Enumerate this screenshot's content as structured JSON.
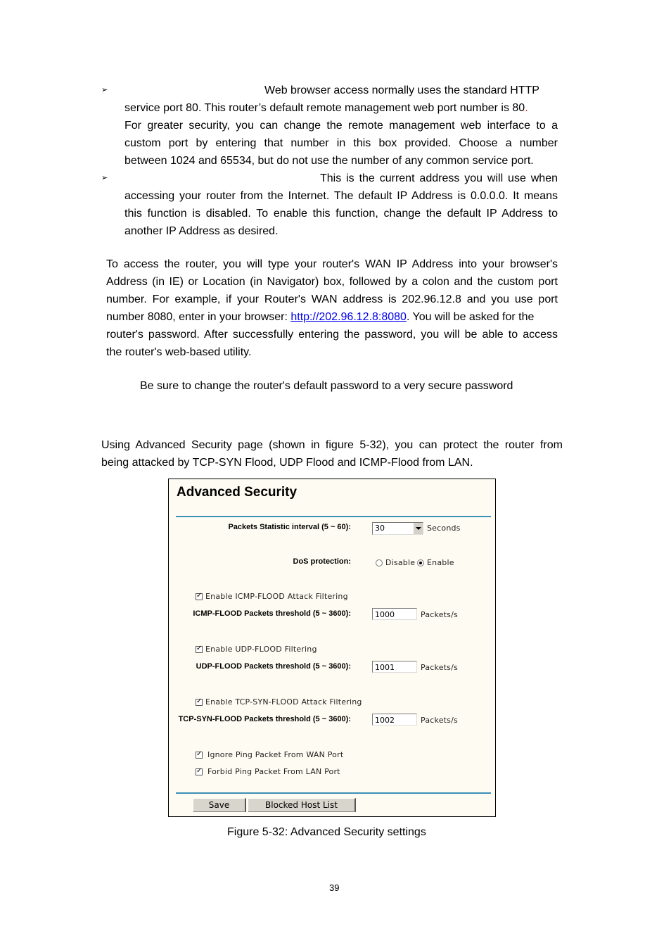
{
  "bullets": [
    {
      "symbol": "➢",
      "lines": [
        "Web browser access normally uses the standard HTTP",
        "service port 80. This router’s default remote management web port number is 80",
        "For greater security, you can change the remote management web interface to a",
        "custom port by entering that number in this box provided. Choose a number",
        "between 1024 and 65534, but do not use the number of any common service port."
      ],
      "red_period": "."
    },
    {
      "symbol": "➢",
      "lines": [
        "This is the current address you will use when",
        "accessing your router from the Internet. The default IP Address is 0.0.0.0. It means",
        "this function is disabled. To enable this function, change the default IP Address to",
        "another IP Address as desired."
      ]
    }
  ],
  "paragraph1": {
    "lines": [
      "To access the router, you will type your router's WAN IP Address into your browser's",
      "Address (in IE) or Location (in Navigator) box, followed by a colon and the custom port",
      "number. For example, if your Router's WAN address is 202.96.12.8 and you use port"
    ],
    "line4_before": "number 8080, enter in your browser: ",
    "link": "http://202.96.12.8:8080",
    "line4_after": ". You will be asked for the",
    "line5": "router's password. After successfully entering the password, you will be able to access",
    "line6": "the router's web-based utility."
  },
  "note": "Be sure to change the router's default password to a very secure password",
  "intro": {
    "line1": "Using Advanced Security page (shown in figure 5-32), you can protect the router from",
    "line2": "being attacked by TCP-SYN Flood, UDP Flood and ICMP-Flood from LAN."
  },
  "panel": {
    "title": "Advanced Security",
    "interval_label": "Packets Statistic interval (5 ~ 60):",
    "interval_value": "30",
    "interval_unit": "Seconds",
    "dos_label": "DoS protection:",
    "dos_options": [
      "Disable",
      "Enable"
    ],
    "dos_selected": "Enable",
    "icmp_checkbox": "Enable ICMP-FLOOD Attack Filtering",
    "icmp_label": "ICMP-FLOOD Packets threshold (5 ~ 3600):",
    "icmp_value": "1000",
    "udp_checkbox": "Enable UDP-FLOOD Filtering",
    "udp_label": "UDP-FLOOD Packets threshold (5 ~ 3600):",
    "udp_value": "1001",
    "tcp_checkbox": "Enable TCP-SYN-FLOOD Attack Filtering",
    "tcp_label": "TCP-SYN-FLOOD Packets threshold (5 ~ 3600):",
    "tcp_value": "1002",
    "unit": "Packets/s",
    "ignore_ping_wan": "Ignore Ping Packet From WAN Port",
    "forbid_ping_lan": "Forbid Ping Packet From LAN Port",
    "save_label": "Save",
    "blocked_label": "Blocked Host List",
    "accent": "#3b8fb8"
  },
  "caption": "Figure 5-32: Advanced Security settings",
  "page_number": "39"
}
